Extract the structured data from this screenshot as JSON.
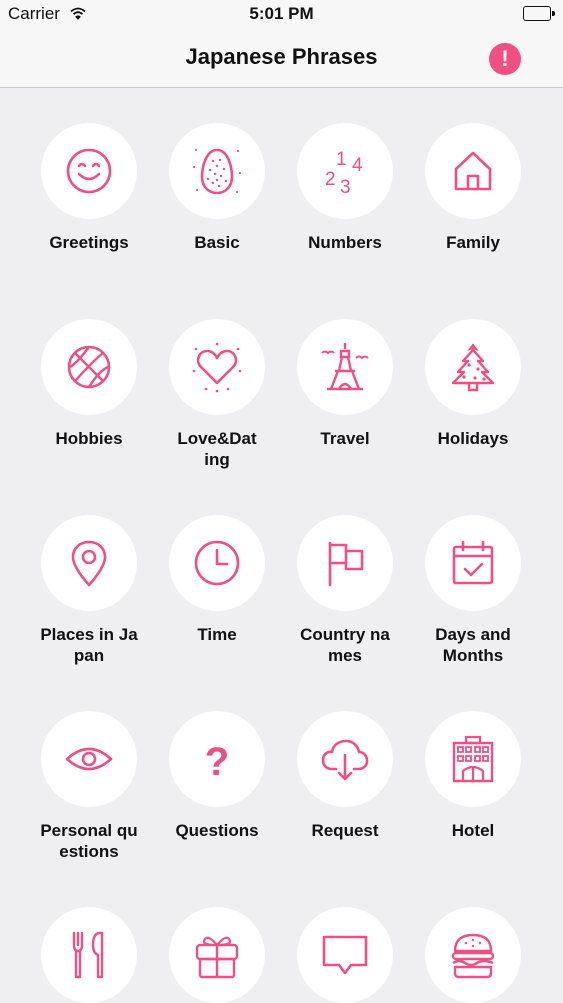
{
  "status_bar": {
    "carrier": "Carrier",
    "time": "5:01 PM"
  },
  "nav": {
    "title": "Japanese Phrases",
    "alert_symbol": "!",
    "accent_color": "#ef4f83"
  },
  "categories": [
    {
      "label": "Greetings",
      "icon": "smiley-icon"
    },
    {
      "label": "Basic",
      "icon": "egg-icon"
    },
    {
      "label": "Numbers",
      "icon": "numbers-icon",
      "icon_text": [
        "1",
        "4",
        "2",
        "3"
      ]
    },
    {
      "label": "Family",
      "icon": "house-icon"
    },
    {
      "label": "Hobbies",
      "icon": "basketball-icon"
    },
    {
      "label": "Love&Dating",
      "icon": "heart-icon"
    },
    {
      "label": "Travel",
      "icon": "eiffel-tower-icon"
    },
    {
      "label": "Holidays",
      "icon": "christmas-tree-icon"
    },
    {
      "label": "Places in Japan",
      "icon": "map-pin-icon"
    },
    {
      "label": "Time",
      "icon": "clock-icon"
    },
    {
      "label": "Country names",
      "icon": "flag-icon"
    },
    {
      "label": "Days and Months",
      "icon": "calendar-icon"
    },
    {
      "label": "Personal questions",
      "icon": "eye-icon"
    },
    {
      "label": "Questions",
      "icon": "question-mark-icon",
      "icon_text": [
        "?"
      ]
    },
    {
      "label": "Request",
      "icon": "cloud-download-icon"
    },
    {
      "label": "Hotel",
      "icon": "hotel-icon"
    },
    {
      "label": "",
      "icon": "fork-knife-icon"
    },
    {
      "label": "",
      "icon": "gift-icon"
    },
    {
      "label": "",
      "icon": "speech-bubble-icon"
    },
    {
      "label": "",
      "icon": "burger-icon"
    }
  ]
}
